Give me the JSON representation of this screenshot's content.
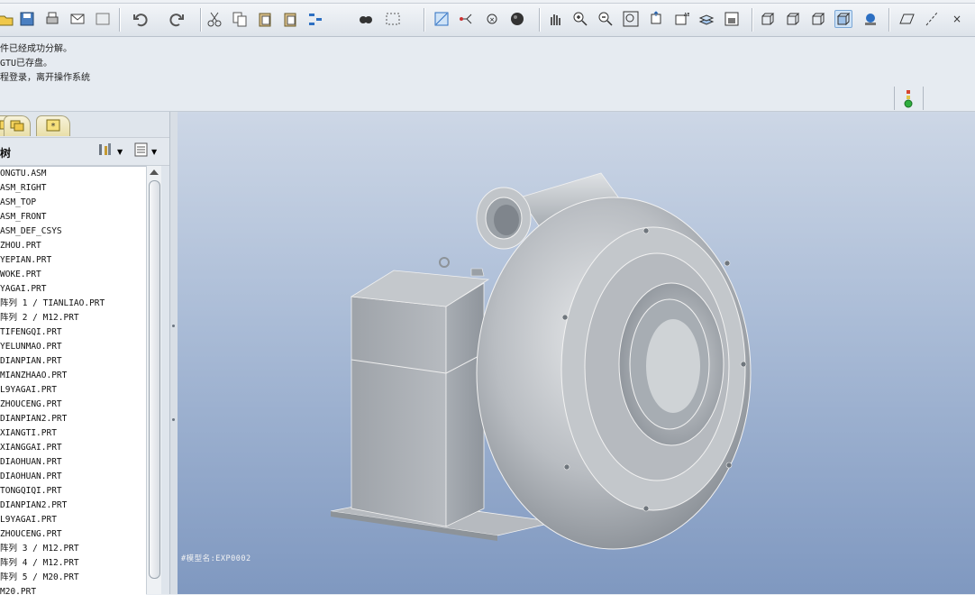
{
  "toolbar": {
    "buttons": [
      {
        "name": "open-icon"
      },
      {
        "name": "save-icon"
      },
      {
        "name": "print-icon"
      },
      {
        "name": "send-mail-icon"
      },
      {
        "name": "close-window-icon"
      },
      {
        "name": "undo-icon"
      },
      {
        "name": "redo-icon"
      },
      {
        "name": "cut-icon"
      },
      {
        "name": "copy-icon"
      },
      {
        "name": "paste-icon"
      },
      {
        "name": "paste-special-icon"
      },
      {
        "name": "regenerate-icon"
      },
      {
        "name": "find-icon"
      },
      {
        "name": "select-box-icon"
      },
      {
        "name": "datum-display-icon"
      },
      {
        "name": "axis-display-icon"
      },
      {
        "name": "point-display-icon"
      },
      {
        "name": "shade-sphere-icon"
      },
      {
        "name": "spin-hand-icon"
      },
      {
        "name": "zoom-in-icon"
      },
      {
        "name": "zoom-out-icon"
      },
      {
        "name": "refit-icon"
      },
      {
        "name": "reorient-icon"
      },
      {
        "name": "saved-views-icon"
      },
      {
        "name": "layers-icon"
      },
      {
        "name": "view-manager-icon"
      },
      {
        "name": "wireframe-icon"
      },
      {
        "name": "hidden-line-icon"
      },
      {
        "name": "no-hidden-icon"
      },
      {
        "name": "shading-icon"
      },
      {
        "name": "enhanced-realism-icon"
      },
      {
        "name": "datum-plane-icon"
      },
      {
        "name": "datum-axis-icon"
      },
      {
        "name": "datum-point-icon"
      }
    ]
  },
  "messages": [
    "件已经成功分解。",
    "GTU已存盘。",
    "程登录，离开操作系统"
  ],
  "tree": {
    "title": "树",
    "items": [
      "ONGTU.ASM",
      "ASM_RIGHT",
      "ASM_TOP",
      "ASM_FRONT",
      "ASM_DEF_CSYS",
      "ZHOU.PRT",
      "YEPIAN.PRT",
      "WOKE.PRT",
      "YAGAI.PRT",
      "阵列 1 / TIANLIAO.PRT",
      "阵列 2 / M12.PRT",
      "TIFENGQI.PRT",
      "YELUNMAO.PRT",
      "DIANPIAN.PRT",
      "MIANZHAAO.PRT",
      "L9YAGAI.PRT",
      "ZHOUCENG.PRT",
      "DIANPIAN2.PRT",
      "XIANGTI.PRT",
      "XIANGGAI.PRT",
      "DIAOHUAN.PRT",
      "DIAOHUAN.PRT",
      "TONGQIQI.PRT",
      "DIANPIAN2.PRT",
      "L9YAGAI.PRT",
      "ZHOUCENG.PRT",
      "阵列 3 / M12.PRT",
      "阵列 4 / M12.PRT",
      "阵列 5 / M20.PRT",
      "M20.PRT"
    ]
  },
  "viewport": {
    "model_label": "#模型名:EXP0002"
  },
  "colors": {
    "viewport_top": "#cdd7e6",
    "viewport_bottom": "#7f98c0",
    "model_gray": "#b4b8bd"
  }
}
